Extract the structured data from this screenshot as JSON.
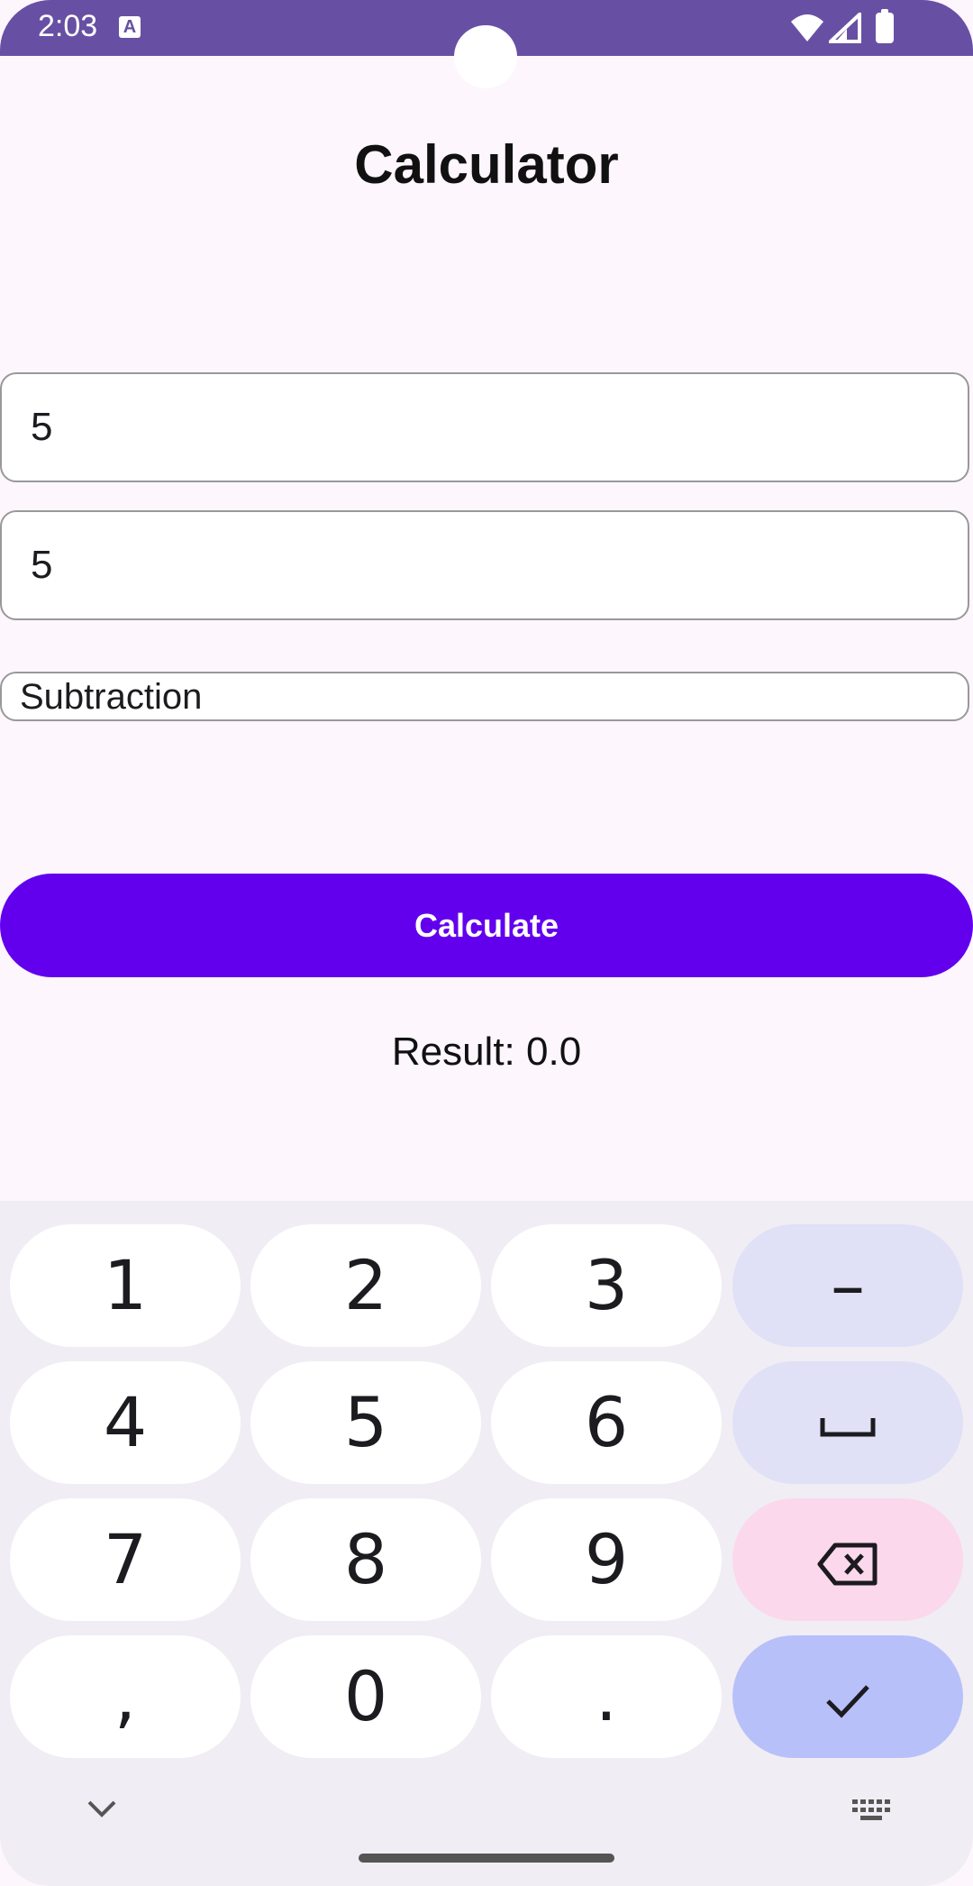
{
  "status_bar": {
    "time": "2:03",
    "notification_icon": "a-icon",
    "bg_color": "#6750a4"
  },
  "app": {
    "title": "Calculator"
  },
  "form": {
    "first_number": "5",
    "second_number": "5",
    "operation": "Subtraction",
    "calculate_label": "Calculate",
    "result_text": "Result: 0.0",
    "accent_color": "#6200ee"
  },
  "keyboard": {
    "rows": [
      [
        "1",
        "2",
        "3",
        "–"
      ],
      [
        "4",
        "5",
        "6",
        "space-icon"
      ],
      [
        "7",
        "8",
        "9",
        "backspace-icon"
      ],
      [
        ",",
        "0",
        ".",
        "check-icon"
      ]
    ],
    "keys": {
      "k1": "1",
      "k2": "2",
      "k3": "3",
      "minus": "–",
      "k4": "4",
      "k5": "5",
      "k6": "6",
      "k7": "7",
      "k8": "8",
      "k9": "9",
      "comma": ",",
      "k0": "0",
      "period": "."
    }
  }
}
